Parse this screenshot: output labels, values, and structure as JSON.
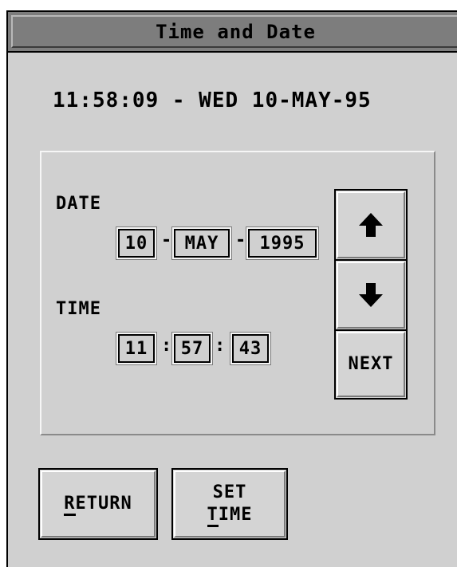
{
  "window": {
    "title": "Time and Date"
  },
  "clock": {
    "display": "11:58:09 - WED 10-MAY-95"
  },
  "date": {
    "label": "DATE",
    "day": "10",
    "month": "MAY",
    "year": "1995",
    "separator": "-"
  },
  "time": {
    "label": "TIME",
    "hours": "11",
    "minutes": "57",
    "seconds": "43",
    "separator": ":"
  },
  "controls": {
    "up_icon": "arrow-up-icon",
    "down_icon": "arrow-down-icon",
    "next_label": "NEXT"
  },
  "buttons": {
    "return_mnemonic": "R",
    "return_rest": "ETURN",
    "set_time_line1": "SET",
    "set_time_mnemonic": "T",
    "set_time_rest": "IME"
  },
  "colors": {
    "window_bg": "#d0d0d0",
    "titlebar_bg": "#7d7d7d"
  }
}
